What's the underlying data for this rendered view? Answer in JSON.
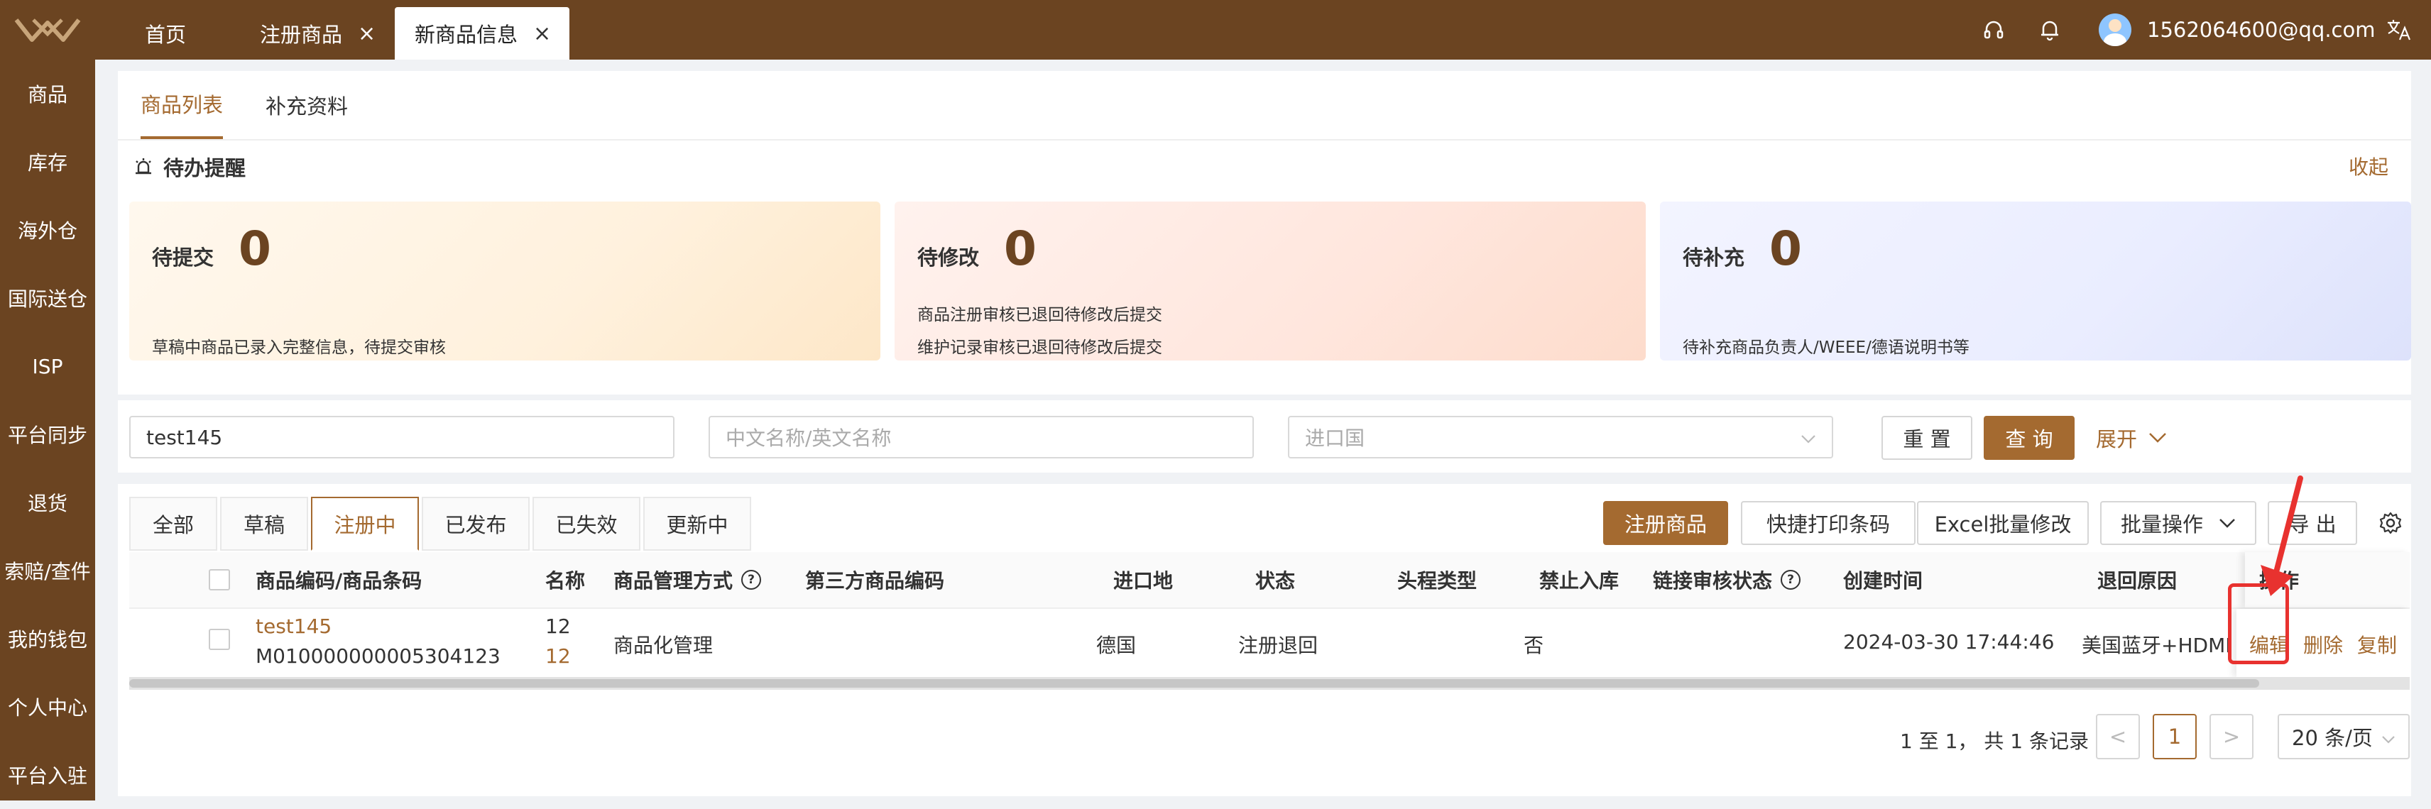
{
  "top_tabs": [
    {
      "label": "首页"
    },
    {
      "label": "注册商品",
      "close": "×"
    },
    {
      "label": "新商品信息",
      "close": "×"
    }
  ],
  "user": {
    "email": "1562064600@qq.com"
  },
  "sidebar": {
    "items": [
      "商品",
      "库存",
      "海外仓",
      "国际送仓",
      "ISP",
      "平台同步",
      "退货",
      "索赔/查件",
      "我的钱包",
      "个人中心",
      "平台入驻"
    ]
  },
  "sub_tabs": [
    "商品列表",
    "补充资料"
  ],
  "todo": {
    "title": "待办提醒",
    "collapse": "收起",
    "cards": [
      {
        "title": "待提交",
        "count": "0",
        "desc": [
          "草稿中商品已录入完整信息，待提交审核"
        ]
      },
      {
        "title": "待修改",
        "count": "0",
        "desc": [
          "商品注册审核已退回待修改后提交",
          "维护记录审核已退回待修改后提交"
        ]
      },
      {
        "title": "待补充",
        "count": "0",
        "desc": [
          "待补充商品负责人/WEEE/德语说明书等"
        ]
      }
    ]
  },
  "search": {
    "code_value": "test145",
    "name_placeholder": "中文名称/英文名称",
    "country_placeholder": "进口国",
    "reset": "重 置",
    "query": "查 询",
    "expand": "展开"
  },
  "status_tabs": [
    "全部",
    "草稿",
    "注册中",
    "已发布",
    "已失效",
    "更新中"
  ],
  "actions": {
    "register": "注册商品",
    "print": "快捷打印条码",
    "excel": "Excel批量修改",
    "batch": "批量操作",
    "export": "导 出"
  },
  "table": {
    "headers": [
      "商品编码/商品条码",
      "名称",
      "商品管理方式",
      "第三方商品编码",
      "进口地",
      "状态",
      "头程类型",
      "禁止入库",
      "链接审核状态",
      "创建时间",
      "退回原因",
      "操作"
    ],
    "rows": [
      {
        "code": "test145",
        "barcode": "M010000000005304123",
        "name1": "12",
        "name2": "12",
        "mgmt": "商品化管理",
        "third": "",
        "import": "德国",
        "status": "注册退回",
        "first_leg": "",
        "forbid": "否",
        "link_status": "",
        "created": "2024-03-30 17:44:46",
        "reason": "美国蓝牙+HDMI",
        "ops": [
          "编辑",
          "删除",
          "复制"
        ]
      }
    ]
  },
  "pagination": {
    "summary": "1 至 1， 共 1 条记录",
    "prev": "<",
    "page": "1",
    "next": ">",
    "page_size": "20 条/页"
  },
  "colors": {
    "brand": "#6b4421",
    "accent": "#a46a30",
    "annotation": "#e8322f"
  }
}
